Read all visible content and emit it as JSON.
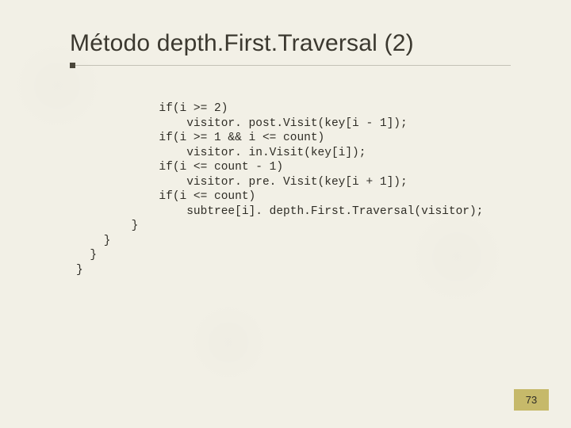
{
  "slide": {
    "title": "Método depth.First.Traversal (2)",
    "code": "            if(i >= 2)\n                visitor. post.Visit(key[i - 1]);\n            if(i >= 1 && i <= count)\n                visitor. in.Visit(key[i]);\n            if(i <= count - 1)\n                visitor. pre. Visit(key[i + 1]);\n            if(i <= count)\n                subtree[i]. depth.First.Traversal(visitor);\n        }\n    }\n  }\n}",
    "page_number": "73"
  }
}
